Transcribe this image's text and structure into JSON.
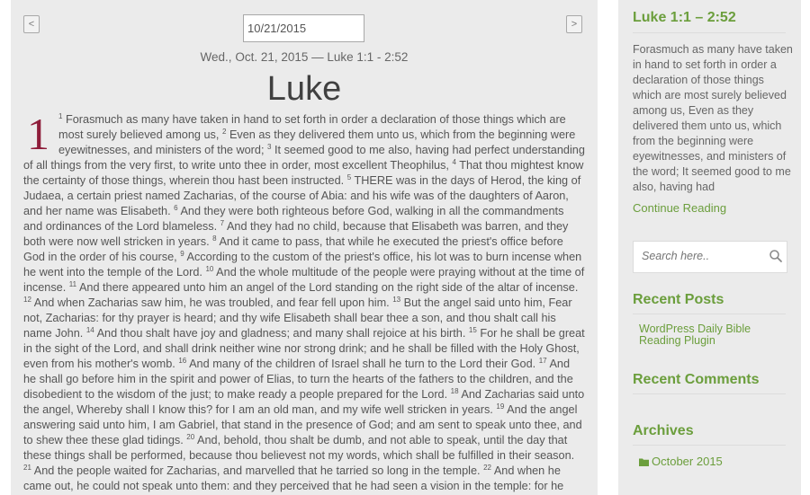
{
  "nav": {
    "prev_label": "<",
    "next_label": ">",
    "date_value": "10/21/2015"
  },
  "reading": {
    "subtitle": "Wed., Oct. 21, 2015 — Luke 1:1 - 2:52",
    "book": "Luke",
    "chapter": "1",
    "verses": [
      {
        "n": "1",
        "t": "Forasmuch as many have taken in hand to set forth in order a declaration of those things which are most surely believed among us,"
      },
      {
        "n": "2",
        "t": "Even as they delivered them unto us, which from the beginning were eyewitnesses, and ministers of the word;"
      },
      {
        "n": "3",
        "t": "It seemed good to me also, having had perfect understanding of all things from the very first, to write unto thee in order, most excellent Theophilus,"
      },
      {
        "n": "4",
        "t": "That thou mightest know the certainty of those things, wherein thou hast been instructed."
      },
      {
        "n": "5",
        "t": "THERE was in the days of Herod, the king of Judaea, a certain priest named Zacharias, of the course of Abia: and his wife was of the daughters of Aaron, and her name was Elisabeth."
      },
      {
        "n": "6",
        "t": "And they were both righteous before God, walking in all the commandments and ordinances of the Lord blameless."
      },
      {
        "n": "7",
        "t": "And they had no child, because that Elisabeth was barren, and they both were now well stricken in years."
      },
      {
        "n": "8",
        "t": "And it came to pass, that while he executed the priest's office before God in the order of his course,"
      },
      {
        "n": "9",
        "t": "According to the custom of the priest's office, his lot was to burn incense when he went into the temple of the Lord."
      },
      {
        "n": "10",
        "t": "And the whole multitude of the people were praying without at the time of incense."
      },
      {
        "n": "11",
        "t": "And there appeared unto him an angel of the Lord standing on the right side of the altar of incense."
      },
      {
        "n": "12",
        "t": "And when Zacharias saw him, he was troubled, and fear fell upon him."
      },
      {
        "n": "13",
        "t": "But the angel said unto him, Fear not, Zacharias: for thy prayer is heard; and thy wife Elisabeth shall bear thee a son, and thou shalt call his name John."
      },
      {
        "n": "14",
        "t": "And thou shalt have joy and gladness; and many shall rejoice at his birth."
      },
      {
        "n": "15",
        "t": "For he shall be great in the sight of the Lord, and shall drink neither wine nor strong drink; and he shall be filled with the Holy Ghost, even from his mother's womb."
      },
      {
        "n": "16",
        "t": "And many of the children of Israel shall he turn to the Lord their God."
      },
      {
        "n": "17",
        "t": "And he shall go before him in the spirit and power of Elias, to turn the hearts of the fathers to the children, and the disobedient to the wisdom of the just; to make ready a people prepared for the Lord."
      },
      {
        "n": "18",
        "t": "And Zacharias said unto the angel, Whereby shall I know this? for I am an old man, and my wife well stricken in years."
      },
      {
        "n": "19",
        "t": "And the angel answering said unto him, I am Gabriel, that stand in the presence of God; and am sent to speak unto thee, and to shew thee these glad tidings."
      },
      {
        "n": "20",
        "t": "And, behold, thou shalt be dumb, and not able to speak, until the day that these things shall be performed, because thou believest not my words, which shall be fulfilled in their season."
      },
      {
        "n": "21",
        "t": "And the people waited for Zacharias, and marvelled that he tarried so long in the temple."
      },
      {
        "n": "22",
        "t": "And when he came out, he could not speak unto them: and they perceived that he had seen a vision in the temple: for he beckoned unto"
      }
    ]
  },
  "sidebar": {
    "excerpt_title": "Luke 1:1 – 2:52",
    "excerpt_text": "Forasmuch as many have taken in hand to set forth in order a declaration of those things which are most surely believed among us, Even as they delivered them unto us, which from the beginning were eyewitnesses, and ministers of the word; It seemed good to me also, having had",
    "continue_label": "Continue Reading",
    "search_placeholder": "Search here..",
    "recent_posts_title": "Recent Posts",
    "recent_posts": [
      "WordPress Daily Bible Reading Plugin"
    ],
    "recent_comments_title": "Recent Comments",
    "archives_title": "Archives",
    "archives": [
      "October 2015"
    ]
  },
  "colors": {
    "accent": "#6b9e3c",
    "chapter_number": "#8e1d3a",
    "panel_background": "#ebebeb"
  },
  "icons": {
    "search": "search-icon",
    "archive": "folder-icon"
  }
}
